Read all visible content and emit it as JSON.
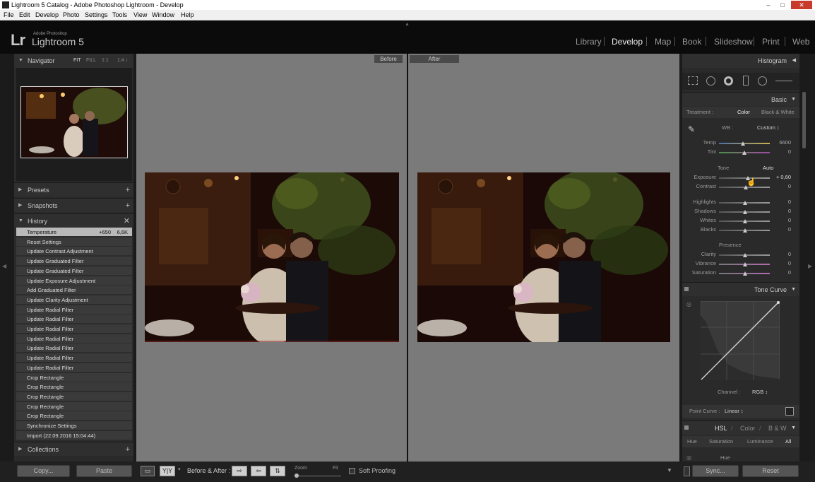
{
  "window": {
    "title": "Lightroom 5 Catalog - Adobe Photoshop Lightroom - Develop",
    "minimize": "–",
    "maximize": "□",
    "close": "✕"
  },
  "menu": [
    "File",
    "Edit",
    "Develop",
    "Photo",
    "Settings",
    "Tools",
    "View",
    "Window",
    "Help"
  ],
  "brand": {
    "logo": "Lr",
    "sub": "Adobe Photoshop",
    "name": "Lightroom 5"
  },
  "modules": [
    "Library",
    "Develop",
    "Map",
    "Book",
    "Slideshow",
    "Print",
    "Web"
  ],
  "active_module": "Develop",
  "left": {
    "navigator": {
      "title": "Navigator",
      "zoom": [
        "FIT",
        "FILL",
        "1:1",
        "1:4 ↕"
      ]
    },
    "presets": "Presets",
    "snapshots": "Snapshots",
    "history": "History",
    "collections": "Collections",
    "history_items": [
      {
        "label": "Temperature",
        "v1": "+650",
        "v2": "6,6K"
      },
      {
        "label": "Reset Settings"
      },
      {
        "label": "Update Contrast Adjustment"
      },
      {
        "label": "Update Graduated Filter"
      },
      {
        "label": "Update Graduated Filter"
      },
      {
        "label": "Update Exposure Adjustment"
      },
      {
        "label": "Add Graduated Filter"
      },
      {
        "label": "Update Clarity Adjustment"
      },
      {
        "label": "Update Radial Filter"
      },
      {
        "label": "Update Radial Filter"
      },
      {
        "label": "Update Radial Filter"
      },
      {
        "label": "Update Radial Filter"
      },
      {
        "label": "Update Radial Filter"
      },
      {
        "label": "Update Radial Filter"
      },
      {
        "label": "Update Radial Filter"
      },
      {
        "label": "Crop Rectangle"
      },
      {
        "label": "Crop Rectangle"
      },
      {
        "label": "Crop Rectangle"
      },
      {
        "label": "Crop Rectangle"
      },
      {
        "label": "Crop Rectangle"
      },
      {
        "label": "Synchronize Settings"
      },
      {
        "label": "Import (22.09.2016 15:04:44)"
      }
    ],
    "copy": "Copy...",
    "paste": "Paste"
  },
  "center": {
    "before": "Before",
    "after": "After"
  },
  "right": {
    "histogram": "Histogram",
    "basic": "Basic",
    "treatment": "Treatment :",
    "color": "Color",
    "bw": "Black & White",
    "wb": "WB :",
    "wb_value": "Custom ↕",
    "sliders": [
      {
        "label": "Temp",
        "value": "6600",
        "pos": 0.5
      },
      {
        "label": "Tint",
        "value": "0",
        "pos": 0.5
      },
      {
        "label": "Exposure",
        "value": "+ 0,60",
        "pos": 0.56
      },
      {
        "label": "Contrast",
        "value": "0",
        "pos": 0.5
      },
      {
        "label": "Highlights",
        "value": "0",
        "pos": 0.5
      },
      {
        "label": "Shadows",
        "value": "0",
        "pos": 0.5
      },
      {
        "label": "Whites",
        "value": "0",
        "pos": 0.5
      },
      {
        "label": "Blacks",
        "value": "0",
        "pos": 0.5
      },
      {
        "label": "Clarity",
        "value": "0",
        "pos": 0.5
      },
      {
        "label": "Vibrance",
        "value": "0",
        "pos": 0.5
      },
      {
        "label": "Saturation",
        "value": "0",
        "pos": 0.5
      }
    ],
    "tone": "Tone",
    "auto": "Auto",
    "presence": "Presence",
    "tone_curve": "Tone Curve",
    "channel": "Channel :",
    "channel_value": "RGB ↕",
    "point_curve": "Point Curve :",
    "point_curve_value": "Linear ↕",
    "hsl": "HSL",
    "hsl_color": "Color",
    "hsl_bw": "B & W",
    "hsl_sep": "/",
    "hsl_tabs": [
      "Hue",
      "Saturation",
      "Luminance",
      "All"
    ],
    "hue": "Hue",
    "sync": "Sync...",
    "reset": "Reset"
  },
  "toolbar": {
    "view_single": "▭",
    "yy": "Y|Y",
    "before_after": "Before & After :",
    "zoom": "Zoom",
    "fit": "Fit",
    "soft_proofing": "Soft Proofing"
  }
}
